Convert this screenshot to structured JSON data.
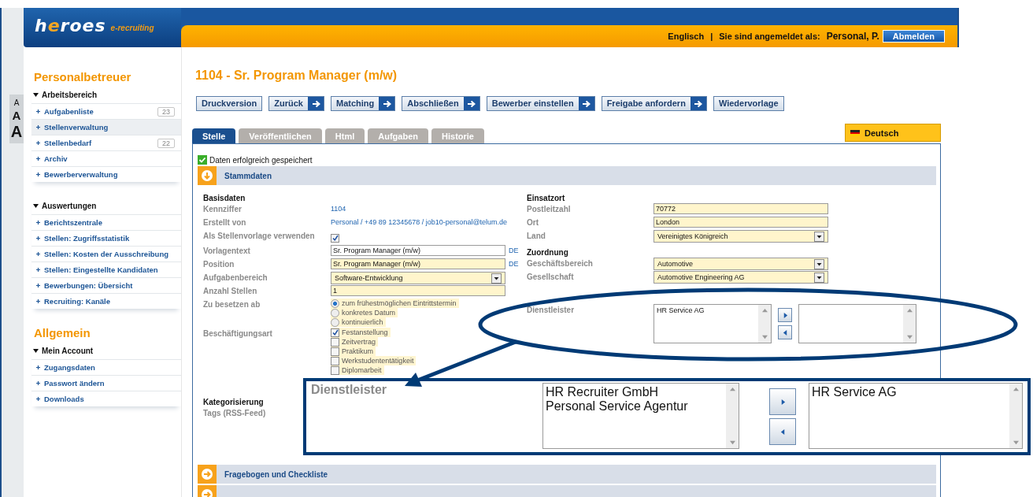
{
  "font_size_switcher": [
    "A",
    "A",
    "A"
  ],
  "logo": {
    "text": "heroes",
    "tagline": "e-recruiting"
  },
  "header": {
    "language_link": "Englisch",
    "separator": "|",
    "login_label": "Sie sind angemeldet als:",
    "user": "Personal, P.",
    "logout_button": "Abmelden"
  },
  "sidebar": {
    "sections": [
      {
        "title": "Personalbetreuer",
        "groups": [
          {
            "title": "Arbeitsbereich",
            "expanded": true,
            "items": [
              {
                "label": "Aufgabenliste",
                "count": "23",
                "selected": false
              },
              {
                "label": "Stellenverwaltung",
                "selected": true
              },
              {
                "label": "Stellenbedarf",
                "count": "22",
                "selected": false
              },
              {
                "label": "Archiv",
                "selected": false
              },
              {
                "label": "Bewerberverwaltung",
                "selected": false
              }
            ]
          },
          {
            "title": "Auswertungen",
            "expanded": true,
            "items": [
              {
                "label": "Berichtszentrale",
                "selected": false
              },
              {
                "label": "Stellen: Zugriffsstatistik",
                "selected": false
              },
              {
                "label": "Stellen: Kosten der Ausschreibung",
                "selected": false
              },
              {
                "label": "Stellen: Eingestellte Kandidaten",
                "selected": false
              },
              {
                "label": "Bewerbungen: Übersicht",
                "selected": false
              },
              {
                "label": "Recruiting: Kanäle",
                "selected": false
              }
            ]
          }
        ]
      },
      {
        "title": "Allgemein",
        "groups": [
          {
            "title": "Mein Account",
            "expanded": true,
            "items": [
              {
                "label": "Zugangsdaten",
                "selected": false
              },
              {
                "label": "Passwort ändern",
                "selected": false
              },
              {
                "label": "Downloads",
                "selected": false
              }
            ]
          }
        ]
      }
    ]
  },
  "page_title": "1104 - Sr. Program Manager (m/w)",
  "toolbar": [
    {
      "label": "Druckversion",
      "kind": "plain"
    },
    {
      "label": "Zurück",
      "kind": "arrow"
    },
    {
      "label": "Matching",
      "kind": "arrow"
    },
    {
      "label": "Abschließen",
      "kind": "arrow"
    },
    {
      "label": "Bewerber einstellen",
      "kind": "arrow"
    },
    {
      "label": "Freigabe anfordern",
      "kind": "arrow"
    },
    {
      "label": "Wiedervorlage",
      "kind": "plain"
    }
  ],
  "tabs": [
    {
      "label": "Stelle",
      "selected": true
    },
    {
      "label": "Veröffentlichen",
      "selected": false
    },
    {
      "label": "Html",
      "selected": false
    },
    {
      "label": "Aufgaben",
      "selected": false
    },
    {
      "label": "Historie",
      "selected": false
    }
  ],
  "language_button": "Deutsch",
  "save_message": "Daten erfolgreich gespeichert",
  "sections": [
    {
      "title": "Stammdaten",
      "expanded": true
    },
    {
      "title": "Fragebogen und Checkliste",
      "expanded": false
    },
    {
      "expanded": false
    }
  ],
  "left_groups": [
    {
      "heading": "Basisdaten",
      "fields": [
        {
          "kind": "text",
          "label": "Kennziffer",
          "value": "1104"
        },
        {
          "kind": "text",
          "label": "Erstellt von",
          "value": "Personal / +49 89 12345678 / job10-personal@telum.de"
        },
        {
          "kind": "checkbox",
          "label": "Als Stellenvorlage verwenden",
          "checked": true
        },
        {
          "kind": "input",
          "label": "Vorlagentext",
          "value": "Sr. Program Manager (m/w)",
          "required": false,
          "lang": "DE"
        },
        {
          "kind": "input",
          "label": "Position",
          "value": "Sr. Program Manager (m/w)",
          "required": true,
          "lang": "DE"
        },
        {
          "kind": "select",
          "label": "Aufgabenbereich",
          "value": "Software-Entwicklung"
        },
        {
          "kind": "input",
          "label": "Anzahl Stellen",
          "value": "1",
          "required": true
        },
        {
          "kind": "radio",
          "label": "Zu besetzen ab",
          "options": [
            {
              "label": "zum frühestmöglichen Eintrittstermin",
              "selected": true
            },
            {
              "label": "konkretes Datum",
              "selected": false
            },
            {
              "label": "kontinuierlich",
              "selected": false
            }
          ]
        },
        {
          "kind": "checklist",
          "label": "Beschäftigungsart",
          "options": [
            {
              "label": "Festanstellung",
              "checked": true
            },
            {
              "label": "Zeitvertrag",
              "checked": false
            },
            {
              "label": "Praktikum",
              "checked": false
            },
            {
              "label": "Werkstudententätigkeit",
              "checked": false
            },
            {
              "label": "Diplomarbeit",
              "checked": false
            }
          ]
        }
      ]
    },
    {
      "heading": "Kategorisierung",
      "fields": [
        {
          "kind": "label",
          "label": "Tags (RSS-Feed)"
        }
      ]
    }
  ],
  "right_groups": [
    {
      "heading": "Einsatzort",
      "fields": [
        {
          "kind": "input",
          "label": "Postleitzahl",
          "value": "70772",
          "required": true
        },
        {
          "kind": "input",
          "label": "Ort",
          "value": "London",
          "required": true
        },
        {
          "kind": "select",
          "label": "Land",
          "value": "Vereinigtes Königreich"
        }
      ]
    },
    {
      "heading": "Zuordnung",
      "fields": [
        {
          "kind": "select",
          "label": "Geschäftsbereich",
          "value": "Automotive"
        },
        {
          "kind": "select",
          "label": "Gesellschaft",
          "value": "Automotive Engineering AG"
        },
        {
          "kind": "transfer",
          "label": "Dienstleister",
          "available": [
            "HR Service AG"
          ]
        }
      ]
    }
  ],
  "callout": {
    "label": "Dienstleister",
    "available": [
      "HR Recruiter GmbH",
      "Personal Service Agentur"
    ],
    "chosen": [
      "HR Service AG"
    ]
  }
}
